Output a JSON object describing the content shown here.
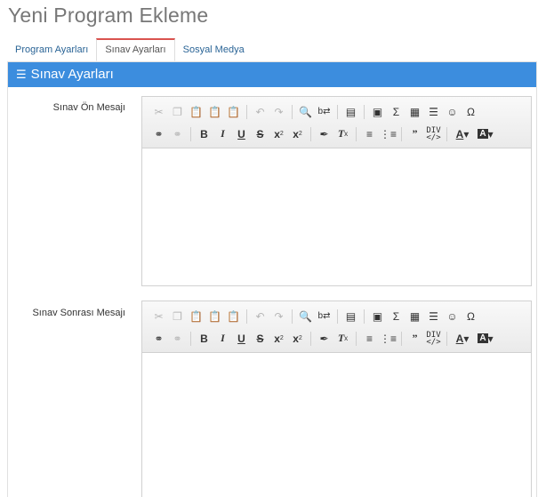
{
  "page": {
    "title": "Yeni Program Ekleme"
  },
  "tabs": [
    {
      "label": "Program Ayarları",
      "active": false
    },
    {
      "label": "Sınav Ayarları",
      "active": true
    },
    {
      "label": "Sosyal Medya",
      "active": false
    }
  ],
  "panel": {
    "title": "Sınav Ayarları",
    "header_color": "#3c8dde"
  },
  "fields": {
    "pre_message": {
      "label": "Sınav Ön Mesajı",
      "value": ""
    },
    "post_message": {
      "label": "Sınav Sonrası Mesajı",
      "value": ""
    }
  },
  "toolbar": {
    "row1": [
      "cut-icon",
      "copy-icon",
      "paste-icon",
      "paste-text-icon",
      "paste-word-icon",
      "undo-icon",
      "redo-icon",
      "find-icon",
      "replace-icon",
      "format-icon",
      "image-icon",
      "math-icon",
      "table-icon",
      "horizontal-rule-icon",
      "smiley-icon",
      "special-char-icon"
    ],
    "row2": [
      "link-icon",
      "unlink-icon",
      "bold-icon",
      "italic-icon",
      "underline-icon",
      "strike-icon",
      "subscript-icon",
      "superscript-icon",
      "copy-format-icon",
      "remove-format-icon",
      "numbered-list-icon",
      "bulleted-list-icon",
      "blockquote-icon",
      "source-icon",
      "text-color-icon",
      "bg-color-icon"
    ]
  }
}
